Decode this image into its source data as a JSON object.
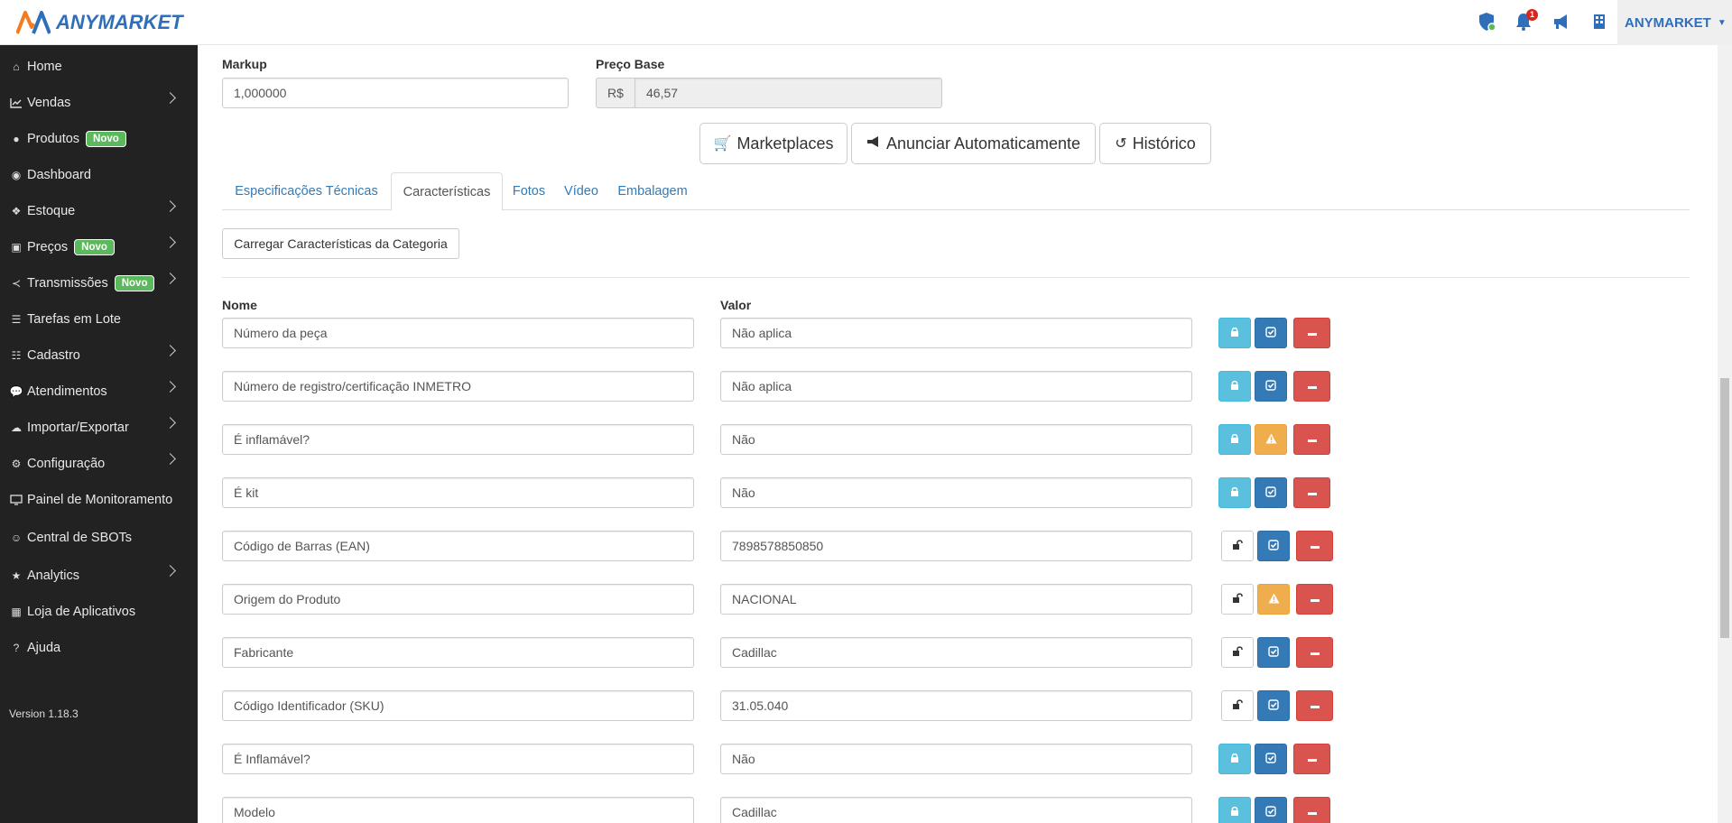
{
  "brand": {
    "name": "ANYMARKET"
  },
  "topbar": {
    "user_label": "ANYMARKET",
    "notification_count": "1"
  },
  "sidebar": {
    "items": [
      {
        "label": "Home",
        "icon": "home-icon"
      },
      {
        "label": "Vendas",
        "icon": "chart-line-icon"
      },
      {
        "label": "Produtos",
        "icon": "product-icon",
        "badge": "Novo"
      },
      {
        "label": "Dashboard",
        "icon": "dashboard-icon"
      },
      {
        "label": "Estoque",
        "icon": "cubes-icon"
      },
      {
        "label": "Preços",
        "icon": "money-icon",
        "badge": "Novo"
      },
      {
        "label": "Transmissões",
        "icon": "share-icon",
        "badge": "Novo"
      },
      {
        "label": "Tarefas em Lote",
        "icon": "tasks-icon"
      },
      {
        "label": "Cadastro",
        "icon": "list-icon"
      },
      {
        "label": "Atendimentos",
        "icon": "comments-icon"
      },
      {
        "label": "Importar/Exportar",
        "icon": "cloud-icon"
      },
      {
        "label": "Configuração",
        "icon": "gear-icon"
      },
      {
        "label": "Painel de Monitoramento",
        "icon": "desktop-icon"
      },
      {
        "label": "Central de SBOTs",
        "icon": "robot-icon"
      },
      {
        "label": "Analytics",
        "icon": "star-icon"
      },
      {
        "label": "Loja de Aplicativos",
        "icon": "grid-icon"
      },
      {
        "label": "Ajuda",
        "icon": "question-icon"
      }
    ],
    "version": "Version 1.18.3"
  },
  "pricing": {
    "markup_label": "Markup",
    "markup_value": "1,000000",
    "preco_base_label": "Preço Base",
    "currency": "R$",
    "preco_base_value": "46,57"
  },
  "actions": {
    "marketplaces": "Marketplaces",
    "anunciar": "Anunciar Automaticamente",
    "historico": "Histórico"
  },
  "tabs": [
    {
      "label": "Especificações Técnicas",
      "active": false
    },
    {
      "label": "Características",
      "active": true
    },
    {
      "label": "Fotos",
      "active": false
    },
    {
      "label": "Vídeo",
      "active": false
    },
    {
      "label": "Embalagem",
      "active": false
    }
  ],
  "characteristics": {
    "load_button": "Carregar Características da Categoria",
    "col_nome": "Nome",
    "col_valor": "Valor",
    "rows": [
      {
        "nome": "Número da peça",
        "valor": "Não aplica",
        "lock": "locked",
        "status": "ok"
      },
      {
        "nome": "Número de registro/certificação INMETRO",
        "valor": "Não aplica",
        "lock": "locked",
        "status": "ok"
      },
      {
        "nome": "É inflamável?",
        "valor": "Não",
        "lock": "locked",
        "status": "warning"
      },
      {
        "nome": "É kit",
        "valor": "Não",
        "lock": "locked",
        "status": "ok"
      },
      {
        "nome": "Código de Barras (EAN)",
        "valor": "7898578850850",
        "lock": "unlocked",
        "status": "ok"
      },
      {
        "nome": "Origem do Produto",
        "valor": "NACIONAL",
        "lock": "unlocked",
        "status": "warning"
      },
      {
        "nome": "Fabricante",
        "valor": "Cadillac",
        "lock": "unlocked",
        "status": "ok"
      },
      {
        "nome": "Código Identificador (SKU)",
        "valor": "31.05.040",
        "lock": "unlocked",
        "status": "ok"
      },
      {
        "nome": "É Inflamável?",
        "valor": "Não",
        "lock": "locked",
        "status": "ok"
      },
      {
        "nome": "Modelo",
        "valor": "Cadillac",
        "lock": "locked",
        "status": "ok"
      }
    ]
  },
  "colors": {
    "sidebar_bg": "#222222",
    "brand_blue": "#2f6fba",
    "brand_orange": "#f47b20",
    "badge_green": "#5cb85c",
    "info": "#5bc0de",
    "primary": "#337ab7",
    "warning": "#f0ad4e",
    "danger": "#d9534f"
  }
}
